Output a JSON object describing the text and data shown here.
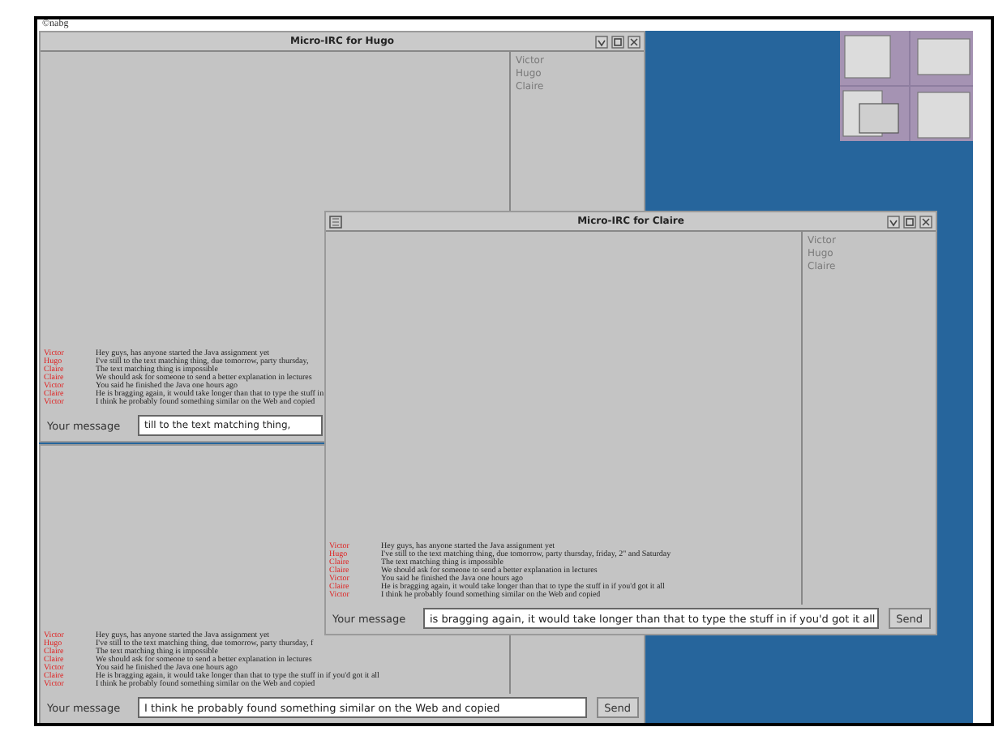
{
  "credit": "©nabg",
  "windows": [
    {
      "title": "Micro-IRC for Hugo",
      "users": [
        "Victor",
        "Hugo",
        "Claire"
      ],
      "messages": [
        {
          "sender": "Victor",
          "text": "Hey guys, has anyone started the Java assignment yet"
        },
        {
          "sender": "Hugo",
          "text": "I've still to the text matching thing, due tomorrow, party thursday,"
        },
        {
          "sender": "Claire",
          "text": "The text matching thing is impossible"
        },
        {
          "sender": "Claire",
          "text": "We should ask for someone to send a better explanation in lectures"
        },
        {
          "sender": "Victor",
          "text": "You said he finished the Java one hours ago"
        },
        {
          "sender": "Claire",
          "text": "He is bragging again, it would take longer than that to type the stuff in"
        },
        {
          "sender": "Victor",
          "text": "I think he probably found something similar on the Web and copied"
        }
      ],
      "input_label": "Your message",
      "input_value": "till to the text matching thing,"
    },
    {
      "messages": [
        {
          "sender": "Victor",
          "text": "Hey guys, has anyone started the Java assignment yet"
        },
        {
          "sender": "Hugo",
          "text": "I've still to the text matching thing, due tomorrow, party thursday, f"
        },
        {
          "sender": "Claire",
          "text": "The text matching thing is impossible"
        },
        {
          "sender": "Claire",
          "text": "We should ask for someone to send a better explanation in lectures"
        },
        {
          "sender": "Victor",
          "text": "You said he finished the Java one hours ago"
        },
        {
          "sender": "Claire",
          "text": "He is bragging again, it would take longer than that to type the stuff in if you'd got it all"
        },
        {
          "sender": "Victor",
          "text": "I think he probably found something similar on the Web and copied"
        }
      ],
      "input_label": "Your message",
      "input_value": "I think he probably found something similar on the Web and copied",
      "send_label": "Send"
    },
    {
      "title": "Micro-IRC for Claire",
      "users": [
        "Victor",
        "Hugo",
        "Claire"
      ],
      "messages": [
        {
          "sender": "Victor",
          "text": "Hey guys, has anyone started the Java assignment yet"
        },
        {
          "sender": "Hugo",
          "text": "I've still to the text matching thing, due tomorrow, party thursday, friday, 2\" and Saturday"
        },
        {
          "sender": "Claire",
          "text": "The text matching thing is impossible"
        },
        {
          "sender": "Claire",
          "text": "We should ask for someone to send a better explanation in lectures"
        },
        {
          "sender": "Victor",
          "text": "You said he finished the Java one hours ago"
        },
        {
          "sender": "Claire",
          "text": "He is bragging again, it would take longer than that to type the stuff in if you'd got it all"
        },
        {
          "sender": "Victor",
          "text": "I think he probably found something similar on the Web and copied"
        }
      ],
      "input_label": "Your message",
      "input_value": "is bragging again, it would take longer than that to type the stuff in if you'd got it all",
      "send_label": "Send"
    }
  ]
}
